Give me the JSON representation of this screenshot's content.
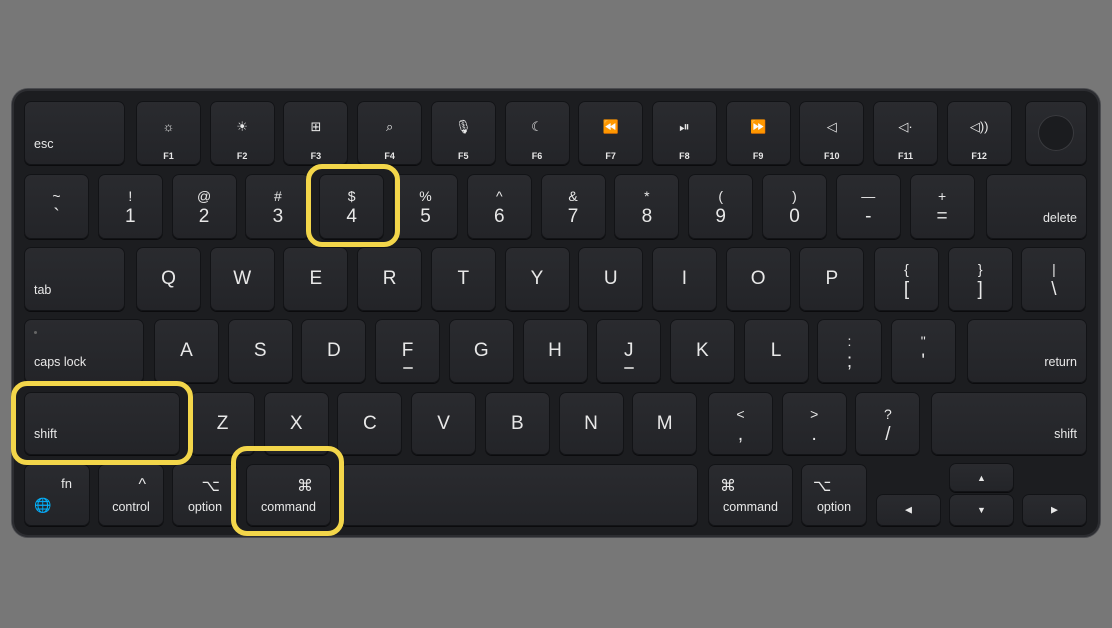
{
  "colors": {
    "background": "#777777",
    "keyboard": "#1c1d20",
    "key": "#27282c",
    "legend": "#e8e8e8",
    "highlight": "#f3d64a"
  },
  "row_fn": {
    "esc": "esc",
    "keys": [
      {
        "label": "F1",
        "icon": "☼",
        "icon_name": "brightness-down-icon"
      },
      {
        "label": "F2",
        "icon": "☀",
        "icon_name": "brightness-up-icon"
      },
      {
        "label": "F3",
        "icon": "⊞",
        "icon_name": "mission-control-icon"
      },
      {
        "label": "F4",
        "icon": "⌕",
        "icon_name": "spotlight-search-icon"
      },
      {
        "label": "F5",
        "icon": "🎙",
        "icon_name": "dictation-microphone-icon"
      },
      {
        "label": "F6",
        "icon": "☾",
        "icon_name": "do-not-disturb-moon-icon"
      },
      {
        "label": "F7",
        "icon": "⏪",
        "icon_name": "rewind-icon"
      },
      {
        "label": "F8",
        "icon": "⏯",
        "icon_name": "play-pause-icon"
      },
      {
        "label": "F9",
        "icon": "⏩",
        "icon_name": "fast-forward-icon"
      },
      {
        "label": "F10",
        "icon": "◁",
        "icon_name": "mute-icon"
      },
      {
        "label": "F11",
        "icon": "◁·",
        "icon_name": "volume-down-icon"
      },
      {
        "label": "F12",
        "icon": "◁))",
        "icon_name": "volume-up-icon"
      }
    ]
  },
  "row_num": {
    "keys": [
      {
        "top": "~",
        "bot": "`"
      },
      {
        "top": "!",
        "bot": "1"
      },
      {
        "top": "@",
        "bot": "2"
      },
      {
        "top": "#",
        "bot": "3"
      },
      {
        "top": "$",
        "bot": "4"
      },
      {
        "top": "%",
        "bot": "5"
      },
      {
        "top": "^",
        "bot": "6"
      },
      {
        "top": "&",
        "bot": "7"
      },
      {
        "top": "*",
        "bot": "8"
      },
      {
        "top": "(",
        "bot": "9"
      },
      {
        "top": ")",
        "bot": "0"
      },
      {
        "top": "—",
        "bot": "-"
      },
      {
        "top": "+",
        "bot": "="
      }
    ],
    "delete": "delete"
  },
  "row_q": {
    "tab": "tab",
    "keys": [
      "Q",
      "W",
      "E",
      "R",
      "T",
      "Y",
      "U",
      "I",
      "O",
      "P"
    ],
    "brackets": [
      {
        "top": "{",
        "bot": "["
      },
      {
        "top": "}",
        "bot": "]"
      },
      {
        "top": "|",
        "bot": "\\"
      }
    ]
  },
  "row_a": {
    "caps": "caps lock",
    "keys": [
      "A",
      "S",
      "D",
      "F",
      "G",
      "H",
      "J",
      "K",
      "L"
    ],
    "punct": [
      {
        "top": ":",
        "bot": ";"
      },
      {
        "top": "\"",
        "bot": "'"
      }
    ],
    "return": "return"
  },
  "row_z": {
    "shift_left": "shift",
    "keys": [
      "Z",
      "X",
      "C",
      "V",
      "B",
      "N",
      "M"
    ],
    "punct": [
      {
        "top": "<",
        "bot": ","
      },
      {
        "top": ">",
        "bot": "."
      },
      {
        "top": "?",
        "bot": "/"
      }
    ],
    "shift_right": "shift"
  },
  "row_bottom": {
    "fn": "fn",
    "globe": "🌐",
    "control": "control",
    "control_sym": "^",
    "option_left": "option",
    "option_sym": "⌥",
    "command_left": "command",
    "command_sym": "⌘",
    "command_right": "command",
    "option_right": "option",
    "arrows": {
      "up": "▲",
      "down": "▼",
      "left": "◀",
      "right": "▶"
    }
  },
  "highlighted_keys": [
    "4",
    "shift",
    "command"
  ]
}
